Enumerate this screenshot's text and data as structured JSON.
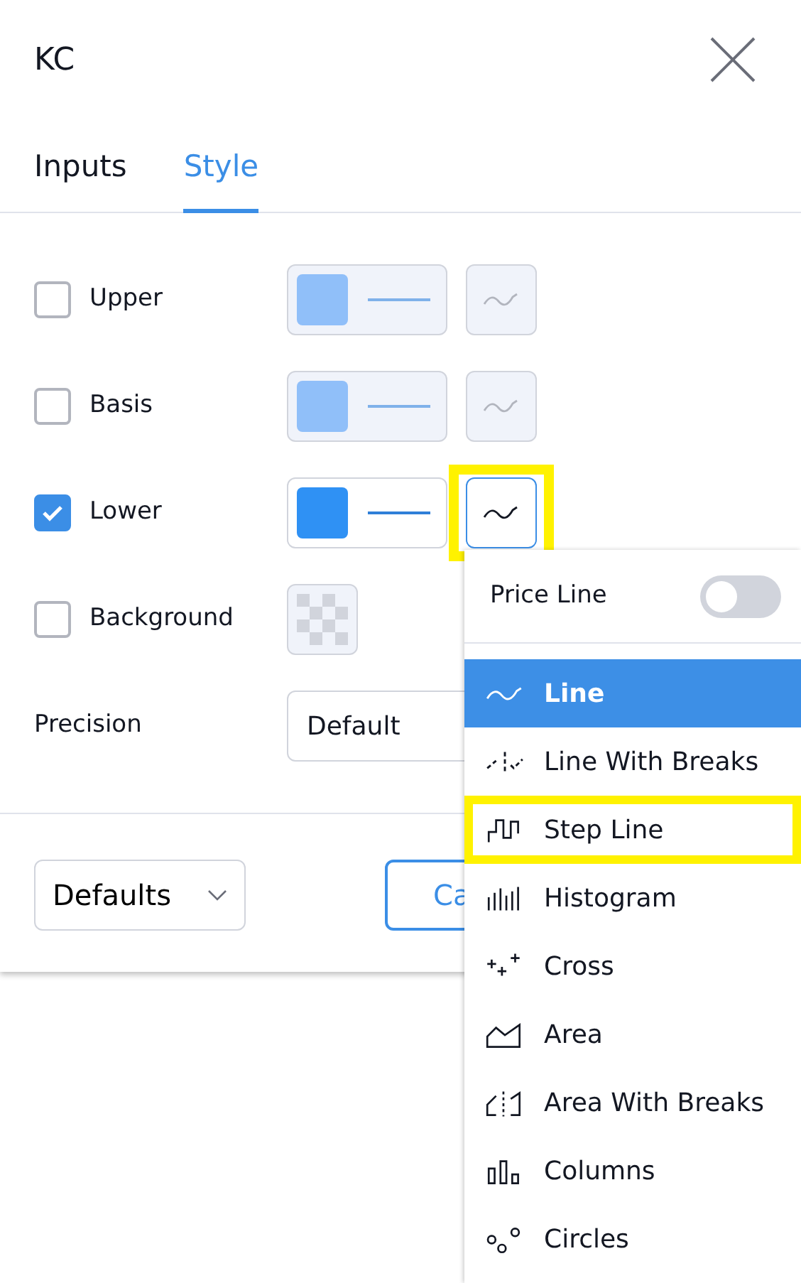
{
  "dialog": {
    "title": "KC",
    "tabs": [
      {
        "label": "Inputs",
        "selected": false
      },
      {
        "label": "Style",
        "selected": true
      }
    ],
    "rows": [
      {
        "kind": "plot",
        "label": "Upper",
        "checked": false,
        "style_open": false,
        "highlighted": false
      },
      {
        "kind": "plot",
        "label": "Basis",
        "checked": false,
        "style_open": false,
        "highlighted": false
      },
      {
        "kind": "plot",
        "label": "Lower",
        "checked": true,
        "style_open": true,
        "highlighted": true
      },
      {
        "kind": "fill",
        "label": "Background",
        "checked": false
      }
    ],
    "precision": {
      "label": "Precision",
      "value": "Default"
    },
    "footer": {
      "defaults": "Defaults",
      "cancel": "Ca"
    }
  },
  "style_menu": {
    "price_line": {
      "label": "Price Line",
      "on": false
    },
    "items": [
      {
        "kind": "line",
        "label": "Line",
        "selected": true,
        "highlighted": false
      },
      {
        "kind": "line-breaks",
        "label": "Line With Breaks",
        "selected": false,
        "highlighted": false
      },
      {
        "kind": "step",
        "label": "Step Line",
        "selected": false,
        "highlighted": true
      },
      {
        "kind": "histogram",
        "label": "Histogram",
        "selected": false,
        "highlighted": false
      },
      {
        "kind": "cross",
        "label": "Cross",
        "selected": false,
        "highlighted": false
      },
      {
        "kind": "area",
        "label": "Area",
        "selected": false,
        "highlighted": false
      },
      {
        "kind": "area-breaks",
        "label": "Area With Breaks",
        "selected": false,
        "highlighted": false
      },
      {
        "kind": "columns",
        "label": "Columns",
        "selected": false,
        "highlighted": false
      },
      {
        "kind": "circles",
        "label": "Circles",
        "selected": false,
        "highlighted": false
      }
    ]
  }
}
